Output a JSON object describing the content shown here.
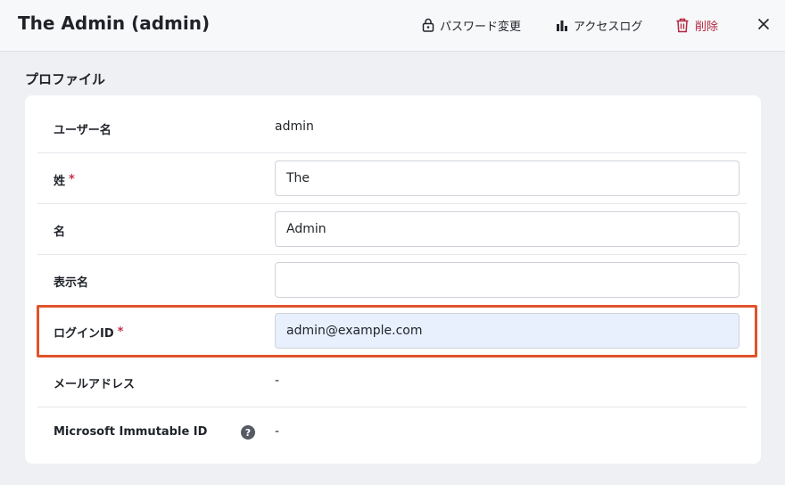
{
  "header": {
    "title": "The Admin (admin)",
    "change_password": "パスワード変更",
    "access_log": "アクセスログ",
    "delete": "削除"
  },
  "section": {
    "title": "プロファイル"
  },
  "fields": {
    "username": {
      "label": "ユーザー名",
      "value": "admin"
    },
    "last_name": {
      "label": "姓",
      "required": "*",
      "value": "The"
    },
    "first_name": {
      "label": "名",
      "value": "Admin"
    },
    "display_name": {
      "label": "表示名",
      "value": ""
    },
    "login_id": {
      "label": "ログインID",
      "required": "*",
      "value": "admin@example.com"
    },
    "email": {
      "label": "メールアドレス",
      "value": "-"
    },
    "immutable_id": {
      "label": "Microsoft Immutable ID",
      "value": "-",
      "help": "?"
    }
  },
  "colors": {
    "accent_danger": "#b3263e",
    "highlight": "#e0532a",
    "required": "#c4314b"
  }
}
